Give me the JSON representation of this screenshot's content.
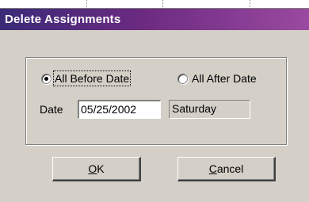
{
  "window": {
    "title": "Delete Assignments"
  },
  "options": {
    "before": {
      "label": "All Before Date",
      "selected": true
    },
    "after": {
      "label": "All After Date",
      "selected": false
    }
  },
  "date": {
    "label": "Date",
    "value": "05/25/2002",
    "weekday": "Saturday"
  },
  "buttons": {
    "ok": {
      "mnemonic": "O",
      "rest": "K"
    },
    "cancel": {
      "mnemonic": "C",
      "rest": "ancel"
    }
  }
}
